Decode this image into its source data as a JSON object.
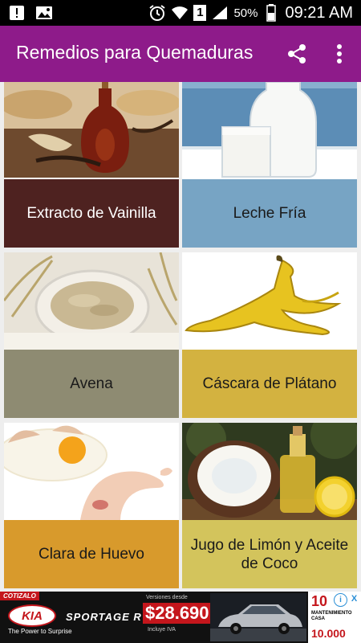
{
  "status_bar": {
    "battery_percent": "50%",
    "time": "09:21 AM",
    "sim_label": "1"
  },
  "app_bar": {
    "title": "Remedios para Quemaduras",
    "share_icon": "share-icon",
    "more_icon": "more-vert-icon"
  },
  "remedies": [
    {
      "label": "Extracto de Vainilla",
      "color": "#4e2220",
      "text_color": "#ffffff"
    },
    {
      "label": "Leche Fría",
      "color": "#77a4c4",
      "text_color": "#1a1a1a"
    },
    {
      "label": "Avena",
      "color": "#8e8b72",
      "text_color": "#1a1a1a"
    },
    {
      "label": "Cáscara de Plátano",
      "color": "#d3b240",
      "text_color": "#1a1a1a"
    },
    {
      "label": "Clara de Huevo",
      "color": "#d89a2c",
      "text_color": "#1a1a1a"
    },
    {
      "label": "Jugo de Limón y Aceite de Coco",
      "color": "#d3c45c",
      "text_color": "#1a1a1a"
    }
  ],
  "ad": {
    "tag": "COTIZALO",
    "brand": "KIA",
    "slogan": "The Power to Surprise",
    "model": "SPORTAGE R",
    "price_caption": "Versiones desde",
    "price": "$28.690",
    "price_note": "Incluye IVA",
    "promo_value_top": "10",
    "promo_text": "MANTENIMIENTO CASA",
    "promo_value_bottom": "10.000",
    "ad_choices": "i",
    "close": "X"
  }
}
